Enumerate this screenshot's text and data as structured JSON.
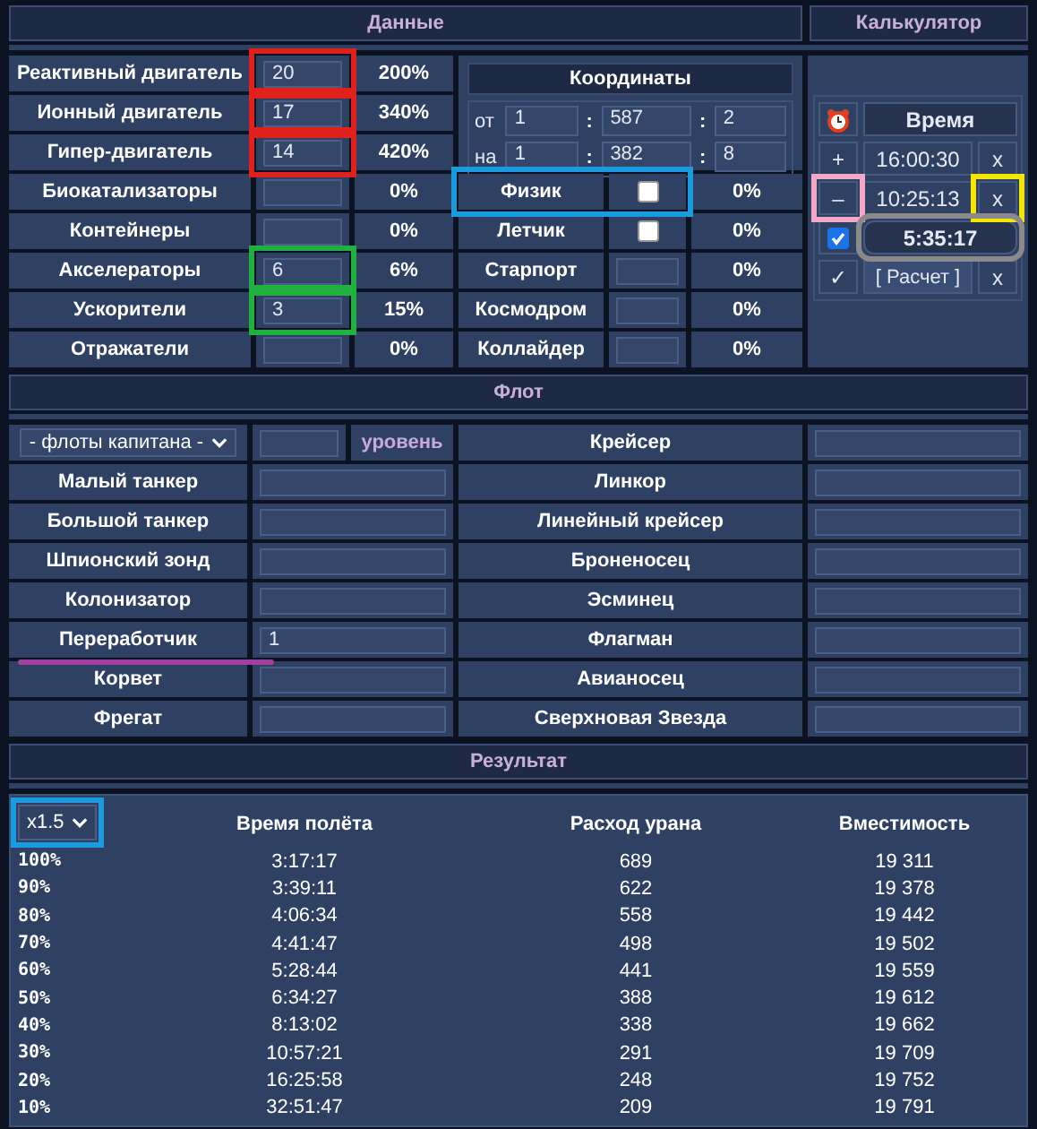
{
  "sections": {
    "data": "Данные",
    "calculator": "Калькулятор",
    "fleet": "Флот",
    "result": "Результат"
  },
  "data_rows": [
    {
      "label": "Реактивный двигатель",
      "value": "20",
      "percent": "200%",
      "color": "#e0201c"
    },
    {
      "label": "Ионный двигатель",
      "value": "17",
      "percent": "340%",
      "color": "#e0201c"
    },
    {
      "label": "Гипер-двигатель",
      "value": "14",
      "percent": "420%",
      "color": "#e0201c"
    },
    {
      "label": "Биокатализаторы",
      "percent": "0%"
    },
    {
      "label": "Контейнеры",
      "percent": "0%"
    },
    {
      "label": "Акселераторы",
      "value": "6",
      "percent": "6%",
      "color": "#1fb040"
    },
    {
      "label": "Ускорители",
      "value": "3",
      "percent": "15%",
      "color": "#1fb040"
    },
    {
      "label": "Отражатели",
      "percent": "0%"
    }
  ],
  "coordinates": {
    "title": "Координаты",
    "rows": [
      {
        "label": "от",
        "fields": [
          "1",
          "587",
          "2"
        ],
        "separators": [
          ":",
          ":"
        ]
      },
      {
        "label": "на",
        "fields": [
          "1",
          "382",
          "8"
        ],
        "separators": [
          ":",
          ":"
        ]
      }
    ]
  },
  "specialists": [
    {
      "kind": "checkbox",
      "label": "Физик",
      "checked": false,
      "percent": "0%",
      "color": "#1a9be0"
    },
    {
      "kind": "checkbox",
      "label": "Летчик",
      "checked": false,
      "percent": "0%"
    },
    {
      "kind": "input",
      "label": "Старпорт",
      "percent": "0%"
    },
    {
      "kind": "input",
      "label": "Космодром",
      "percent": "0%"
    },
    {
      "kind": "input",
      "label": "Коллайдер",
      "percent": "0%"
    }
  ],
  "calculator": {
    "title": "Время",
    "rows": [
      {
        "button": {
          "label": "+"
        },
        "time": "16:00:30",
        "clear": {
          "label": "x"
        }
      },
      {
        "button": {
          "label": "–",
          "color": "#f4a8c8"
        },
        "time": "10:25:13",
        "clear": {
          "label": "x",
          "color": "#f5e600"
        }
      }
    ],
    "result": {
      "checked": true,
      "time": "5:35:17",
      "color": "#8a8a8a"
    },
    "calc": {
      "button": "✓",
      "label": "[ Расчет ]",
      "clear": "x"
    }
  },
  "fleet": {
    "select": "- флоты капитана -",
    "level_label": "уровень",
    "left": [
      {
        "name": "Малый танкер"
      },
      {
        "name": "Большой танкер"
      },
      {
        "name": "Шпионский зонд"
      },
      {
        "name": "Колонизатор"
      },
      {
        "name": "Переработчик",
        "value": "1",
        "color": "#a040a0"
      },
      {
        "name": "Корвет"
      },
      {
        "name": "Фрегат"
      }
    ],
    "right": [
      {
        "name": "Крейсер"
      },
      {
        "name": "Линкор"
      },
      {
        "name": "Линейный крейсер"
      },
      {
        "name": "Броненосец"
      },
      {
        "name": "Эсминец"
      },
      {
        "name": "Флагман"
      },
      {
        "name": "Авианосец"
      },
      {
        "name": "Сверхновая Звезда"
      }
    ]
  },
  "result": {
    "speed_select": {
      "label": "x1.5",
      "color": "#1a9be0"
    },
    "columns": [
      "Время полёта",
      "Расход урана",
      "Вместимость"
    ],
    "rows": [
      {
        "percent": "100%",
        "time": "3:17:17",
        "fuel": "689",
        "capacity": "19 311"
      },
      {
        "percent": "90%",
        "time": "3:39:11",
        "fuel": "622",
        "capacity": "19 378"
      },
      {
        "percent": "80%",
        "time": "4:06:34",
        "fuel": "558",
        "capacity": "19 442"
      },
      {
        "percent": "70%",
        "time": "4:41:47",
        "fuel": "498",
        "capacity": "19 502"
      },
      {
        "percent": "60%",
        "time": "5:28:44",
        "fuel": "441",
        "capacity": "19 559"
      },
      {
        "percent": "50%",
        "time": "6:34:27",
        "fuel": "388",
        "capacity": "19 612"
      },
      {
        "percent": "40%",
        "time": "8:13:02",
        "fuel": "338",
        "capacity": "19 662"
      },
      {
        "percent": "30%",
        "time": "10:57:21",
        "fuel": "291",
        "capacity": "19 709"
      },
      {
        "percent": "20%",
        "time": "16:25:58",
        "fuel": "248",
        "capacity": "19 752"
      },
      {
        "percent": "10%",
        "time": "32:51:47",
        "fuel": "209",
        "capacity": "19 791"
      }
    ]
  }
}
